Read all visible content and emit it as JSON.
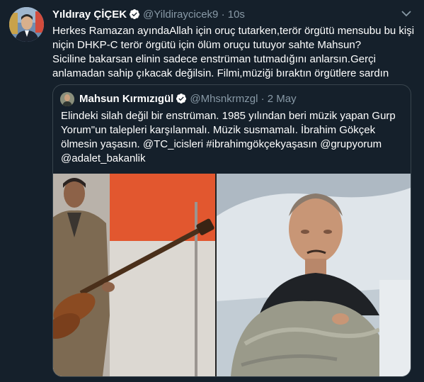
{
  "tweet": {
    "author_name": "Yıldıray ÇİÇEK",
    "handle": "@Yildiraycicek9",
    "separator": "·",
    "time": "10s",
    "lines": [
      "Herkes Ramazan ayındaAllah için oruç tutarken,terör örgütü mensubu bu kişi",
      "niçin DHKP-C terör örgütü için ölüm oruçu tutuyor sahte Mahsun?",
      "Siciline bakarsan elinin sadece enstrüman tutmadığını anlarsın.Gerçi",
      "anlamadan sahip çıkacak değilsin. Filmi,müziği bıraktın örgütlere sardın"
    ]
  },
  "quoted": {
    "author_name": "Mahsun Kırmızıgül",
    "handle": "@Mhsnkrmzgl",
    "separator": "·",
    "date": "2 May",
    "lines": [
      "Elindeki silah değil bir enstrüman. 1985 yılından beri müzik yapan Gurp",
      "Yorum\"un talepleri karşılanmalı. Müzik susmamalı. İbrahim Gökçek",
      "ölmesin yaşasın.  @TC_icisleri #ibrahimgökçekyaşasın @grupyorum",
      "@adalet_bakanlik"
    ]
  },
  "icons": {
    "verified": "verified-badge-icon",
    "more": "chevron-down-icon"
  },
  "colors": {
    "background": "#15202b",
    "muted": "#8899a6",
    "border": "#38444d",
    "verified": "#ffffff"
  }
}
